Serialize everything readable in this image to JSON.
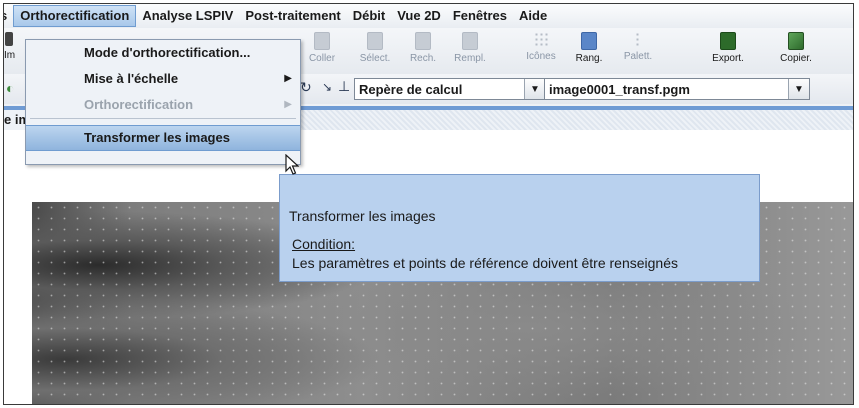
{
  "menubar": {
    "items": [
      {
        "label": "s",
        "name": "menu-item-fichier-partial"
      },
      {
        "label": "Orthorectification",
        "name": "menu-orthorectification",
        "active": true
      },
      {
        "label": "Analyse LSPIV",
        "name": "menu-analyse-lspiv"
      },
      {
        "label": "Post-traitement",
        "name": "menu-post-traitement"
      },
      {
        "label": "Débit",
        "name": "menu-debit"
      },
      {
        "label": "Vue 2D",
        "name": "menu-vue-2d"
      },
      {
        "label": "Fenêtres",
        "name": "menu-fenetres"
      },
      {
        "label": "Aide",
        "name": "menu-aide"
      }
    ]
  },
  "toolbar": {
    "left_label": "Im",
    "tools": [
      {
        "label": "Coller",
        "name": "coller-button",
        "icon": "paste-icon"
      },
      {
        "label": "Sélect.",
        "name": "select-button",
        "icon": "select-icon"
      },
      {
        "label": "Rech.",
        "name": "rech-button",
        "icon": "search-icon"
      },
      {
        "label": "Rempl.",
        "name": "rempl-button",
        "icon": "replace-icon"
      },
      {
        "label": "Icônes",
        "name": "icones-button",
        "icon": "icons-view-icon"
      },
      {
        "label": "Rang.",
        "name": "rang-button",
        "icon": "arrange-icon"
      },
      {
        "label": "Palett.",
        "name": "palett-button",
        "icon": "palette-icon"
      },
      {
        "label": "Export.",
        "name": "export-button",
        "icon": "export-icon"
      },
      {
        "label": "Copier.",
        "name": "copier-button",
        "icon": "copy-image-icon"
      }
    ]
  },
  "toolbar2": {
    "repere": "Repère de calcul",
    "image": "image0001_transf.pgm"
  },
  "panel": {
    "title": "e image transformée"
  },
  "dropdown": {
    "items": [
      {
        "label": "Mode d'orthorectification...",
        "name": "dd-mode-orthorectification"
      },
      {
        "label": "Mise à l'échelle",
        "name": "dd-mise-a-l-echelle",
        "submenu": "▶"
      },
      {
        "label": "Orthorectification",
        "name": "dd-orthorectification",
        "submenu": "▶",
        "disabled": true
      },
      {
        "label": "Transformer les images",
        "name": "dd-transformer-les-images",
        "selected": true
      }
    ]
  },
  "tooltip": {
    "title": "Transformer les images",
    "condition_label": "Condition:",
    "condition_text": "Les paramètres et points de référence doivent être renseignés"
  },
  "colors": {
    "accent": "#6f9bd4",
    "menu_highlight": "#a8c8ea",
    "tooltip_bg": "#b9d1ee"
  }
}
